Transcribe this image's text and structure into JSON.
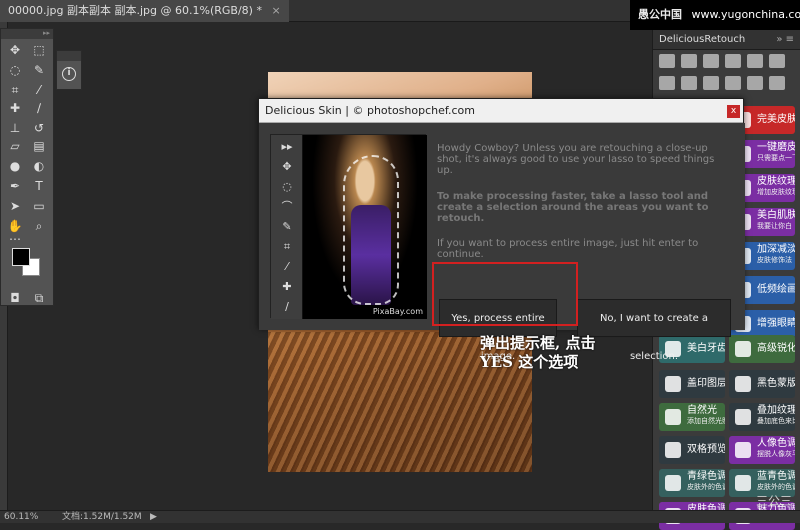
{
  "document_tab": {
    "title": "00000.jpg 副本副本 副本.jpg @ 60.1%(RGB/8) *",
    "close": "×"
  },
  "watermark": {
    "brand": "愚公中国",
    "url": "www.yugonchina.com"
  },
  "toolbar": {
    "grip": "▸▸",
    "tools": [
      {
        "icon": "move-icon",
        "glyph": "✥"
      },
      {
        "icon": "marquee-icon",
        "glyph": "⬚"
      },
      {
        "icon": "lasso-icon",
        "glyph": "◌"
      },
      {
        "icon": "quick-select-icon",
        "glyph": "✎"
      },
      {
        "icon": "crop-icon",
        "glyph": "⌗"
      },
      {
        "icon": "eyedropper-icon",
        "glyph": "⁄"
      },
      {
        "icon": "healing-icon",
        "glyph": "✚"
      },
      {
        "icon": "brush-icon",
        "glyph": "∕"
      },
      {
        "icon": "stamp-icon",
        "glyph": "⊥"
      },
      {
        "icon": "history-brush-icon",
        "glyph": "↺"
      },
      {
        "icon": "eraser-icon",
        "glyph": "▱"
      },
      {
        "icon": "gradient-icon",
        "glyph": "▤"
      },
      {
        "icon": "blur-icon",
        "glyph": "●"
      },
      {
        "icon": "dodge-icon",
        "glyph": "◐"
      },
      {
        "icon": "pen-icon",
        "glyph": "✒"
      },
      {
        "icon": "type-icon",
        "glyph": "T"
      },
      {
        "icon": "path-select-icon",
        "glyph": "➤"
      },
      {
        "icon": "shape-icon",
        "glyph": "▭"
      },
      {
        "icon": "hand-icon",
        "glyph": "✋"
      },
      {
        "icon": "zoom-icon",
        "glyph": "⌕"
      },
      {
        "icon": "more-icon",
        "glyph": "…"
      },
      {
        "icon": "quick-mask-icon",
        "glyph": "◘"
      },
      {
        "icon": "screen-mode-icon",
        "glyph": "⧉"
      }
    ]
  },
  "mini_panel": {
    "info_glyph": "i"
  },
  "status_bar": {
    "zoom": "60.11%",
    "doc": "文档:1.52M/1.52M",
    "arrow": "▶"
  },
  "delicious_retouch": {
    "title": "DeliciousRetouch",
    "controls": "»  ≡",
    "buttons": [
      {
        "label": "完美皮肤",
        "sub": "",
        "color": "#c62828"
      },
      {
        "label": "一键磨皮",
        "sub": "只需要点一下",
        "color": "#7b2ea3"
      },
      {
        "label": "皮肤纹理",
        "sub": "增加皮肤纹理",
        "color": "#7b2ea3"
      },
      {
        "label": "美白肌肤",
        "sub": "我要让你白",
        "color": "#7b2ea3"
      },
      {
        "label": "加深减淡",
        "sub": "皮肤修饰法",
        "color": "#2b5fa8"
      },
      {
        "label": "低频绘画",
        "sub": "",
        "color": "#2b5fa8"
      },
      {
        "label": "增强眼睛",
        "sub": "",
        "color": "#2b5fa8"
      },
      {
        "label": "美白牙齿",
        "sub": "",
        "color": "#2f6a6a"
      },
      {
        "label": "高级锐化",
        "sub": "",
        "color": "#3e6b3e"
      },
      {
        "label": "盖印图层",
        "sub": "",
        "color": "#2f3a40"
      },
      {
        "label": "黑色蒙版",
        "sub": "",
        "color": "#2f3a40"
      },
      {
        "label": "自然光",
        "sub": "添加自然光照",
        "color": "#3e6b3e"
      },
      {
        "label": "叠加纹理",
        "sub": "叠加底色来比",
        "color": "#2f3a40"
      },
      {
        "label": "双格预览",
        "sub": "",
        "color": "#2f3a40"
      },
      {
        "label": "人像色调",
        "sub": "摆脱人像灰平",
        "color": "#7b2ea3"
      },
      {
        "label": "青绿色调",
        "sub": "皮肤外的色调",
        "color": "#35605e"
      },
      {
        "label": "蓝青色调",
        "sub": "皮肤外的色调",
        "color": "#35605e"
      },
      {
        "label": "皮肤色调",
        "sub": "统一皮肤颜色",
        "color": "#7b2ea3"
      },
      {
        "label": "魅力色调",
        "sub": "统一皮肤颜色",
        "color": "#7b2ea3"
      }
    ]
  },
  "dialog": {
    "title": "Delicious Skin | © photoshopchef.com",
    "close": "x",
    "preview_watermark": "PixaBay.com",
    "paragraph1": "Howdy Cowboy? Unless you are retouching a close-up shot, it's always good to use your lasso to speed things up.",
    "paragraph2": "To make processing faster, take a lasso tool and create a selection around the areas you want to retouch.",
    "paragraph3": "If you want to process entire image, just hit enter to continue.",
    "yes_button": "Yes, process entire image.",
    "no_button": "No, I want to create a selection."
  },
  "annotation": {
    "line1": "弹出提示框, 点击",
    "line2": "YES 这个选项"
  },
  "bottom_watermark": "三公三"
}
